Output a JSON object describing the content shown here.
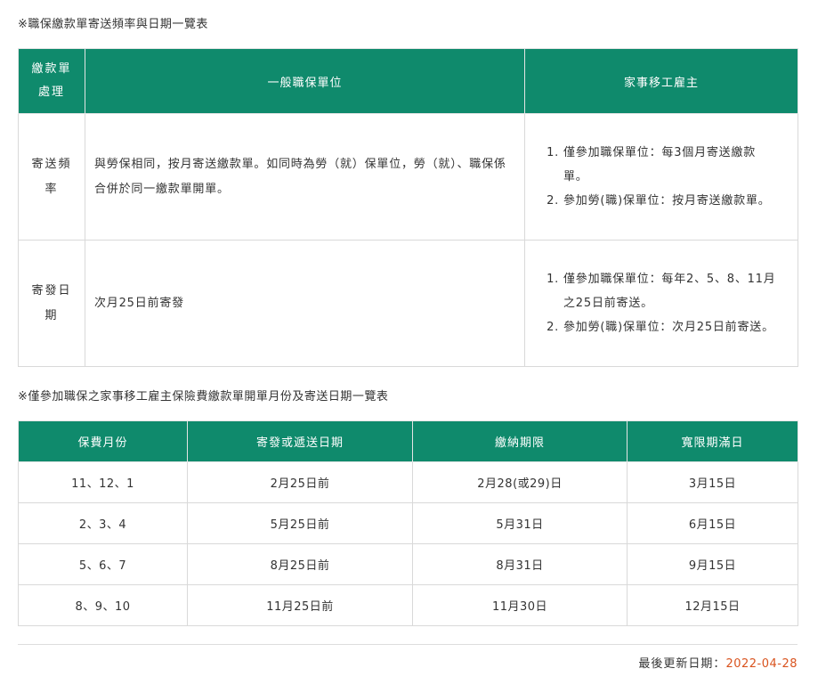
{
  "caption1": "※職保繳款單寄送頻率與日期一覽表",
  "caption2": "※僅參加職保之家事移工雇主保險費繳款單開單月份及寄送日期一覽表",
  "freq_table": {
    "headers": {
      "processing": "繳款單處理",
      "general": "一般職保單位",
      "domestic": "家事移工雇主"
    },
    "rows": [
      {
        "label": "寄送頻率",
        "general": "與勞保相同，按月寄送繳款單。如同時為勞（就）保單位，勞（就）、職保係合併於同一繳款單開單。",
        "domestic": [
          "僅參加職保單位：每3個月寄送繳款單。",
          "參加勞(職)保單位：按月寄送繳款單。"
        ]
      },
      {
        "label": "寄發日期",
        "general": "次月25日前寄發",
        "domestic": [
          "僅參加職保單位：每年2、5、8、11月之25日前寄送。",
          "參加勞(職)保單位：次月25日前寄送。"
        ]
      }
    ]
  },
  "month_table": {
    "headers": [
      "保費月份",
      "寄發或遞送日期",
      "繳納期限",
      "寬限期滿日"
    ],
    "rows": [
      [
        "11、12、1",
        "2月25日前",
        "2月28(或29)日",
        "3月15日"
      ],
      [
        "2、3、4",
        "5月25日前",
        "5月31日",
        "6月15日"
      ],
      [
        "5、6、7",
        "8月25日前",
        "8月31日",
        "9月15日"
      ],
      [
        "8、9、10",
        "11月25日前",
        "11月30日",
        "12月15日"
      ]
    ]
  },
  "footer": {
    "updated_label": "最後更新日期：",
    "updated_date": "2022-04-28"
  },
  "colors": {
    "header_bg": "#0f8a6c",
    "date_accent": "#d9531e"
  }
}
